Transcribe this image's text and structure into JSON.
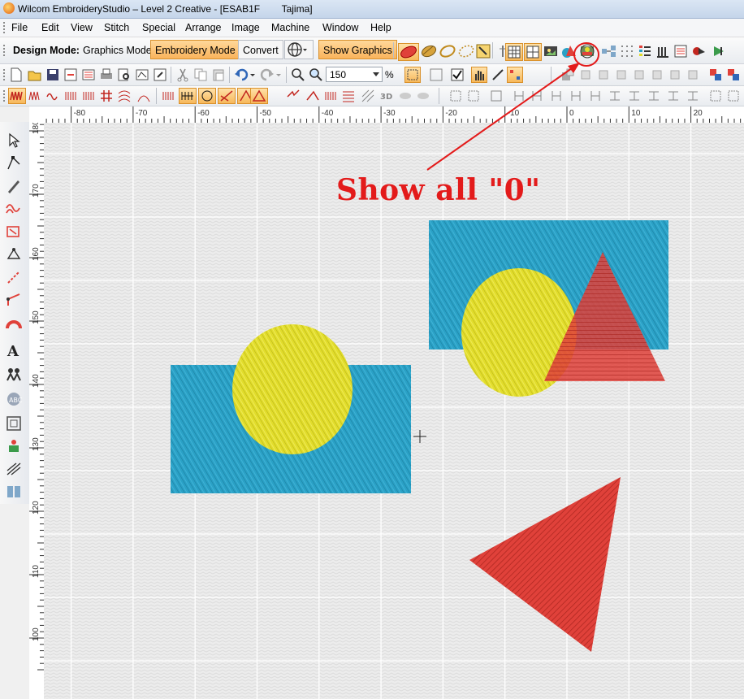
{
  "window": {
    "title": "Wilcom EmbroideryStudio – Level 2 Creative - [ESAB1F        Tajima]"
  },
  "menu": [
    {
      "label": "File"
    },
    {
      "label": "Edit"
    },
    {
      "label": "View"
    },
    {
      "label": "Stitch"
    },
    {
      "label": "Special"
    },
    {
      "label": "Arrange"
    },
    {
      "label": "Image"
    },
    {
      "label": "Machine"
    },
    {
      "label": "Window"
    },
    {
      "label": "Help"
    }
  ],
  "design_mode": {
    "label": "Design Mode:",
    "graphics_mode": "Graphics Mode",
    "embroidery_mode": "Embroidery Mode",
    "convert": "Convert",
    "show_graphics": "Show Graphics"
  },
  "zoom": {
    "value": "150",
    "unit": "%"
  },
  "ruler": {
    "top_labels": [
      "-80",
      "-70",
      "-60",
      "-50",
      "-40",
      "-30",
      "-20",
      "-10",
      "0",
      "10",
      "20"
    ],
    "left_labels": [
      "180",
      "170",
      "160",
      "150",
      "140",
      "130",
      "120",
      "110",
      "100"
    ]
  },
  "annotation": {
    "text": "Show all \"0\"",
    "color": "#e31b1b"
  },
  "colors": {
    "blue": "#2aa1c6",
    "yellow": "#e2dd2b",
    "red": "#e0413a",
    "highlight": "#f9b35b"
  },
  "icons": {
    "file_new": "new-document-icon",
    "open": "open-folder-icon",
    "save": "save-icon",
    "print": "print-icon",
    "zoom": "zoom-icon",
    "undo": "undo-icon",
    "redo": "redo-icon",
    "select": "select-arrow-icon",
    "reshape": "reshape-icon",
    "digitize": "digitize-icon",
    "lettering": "lettering-icon",
    "monogram": "monogram-icon",
    "show_all_zero": "show-all-zero-icon"
  }
}
